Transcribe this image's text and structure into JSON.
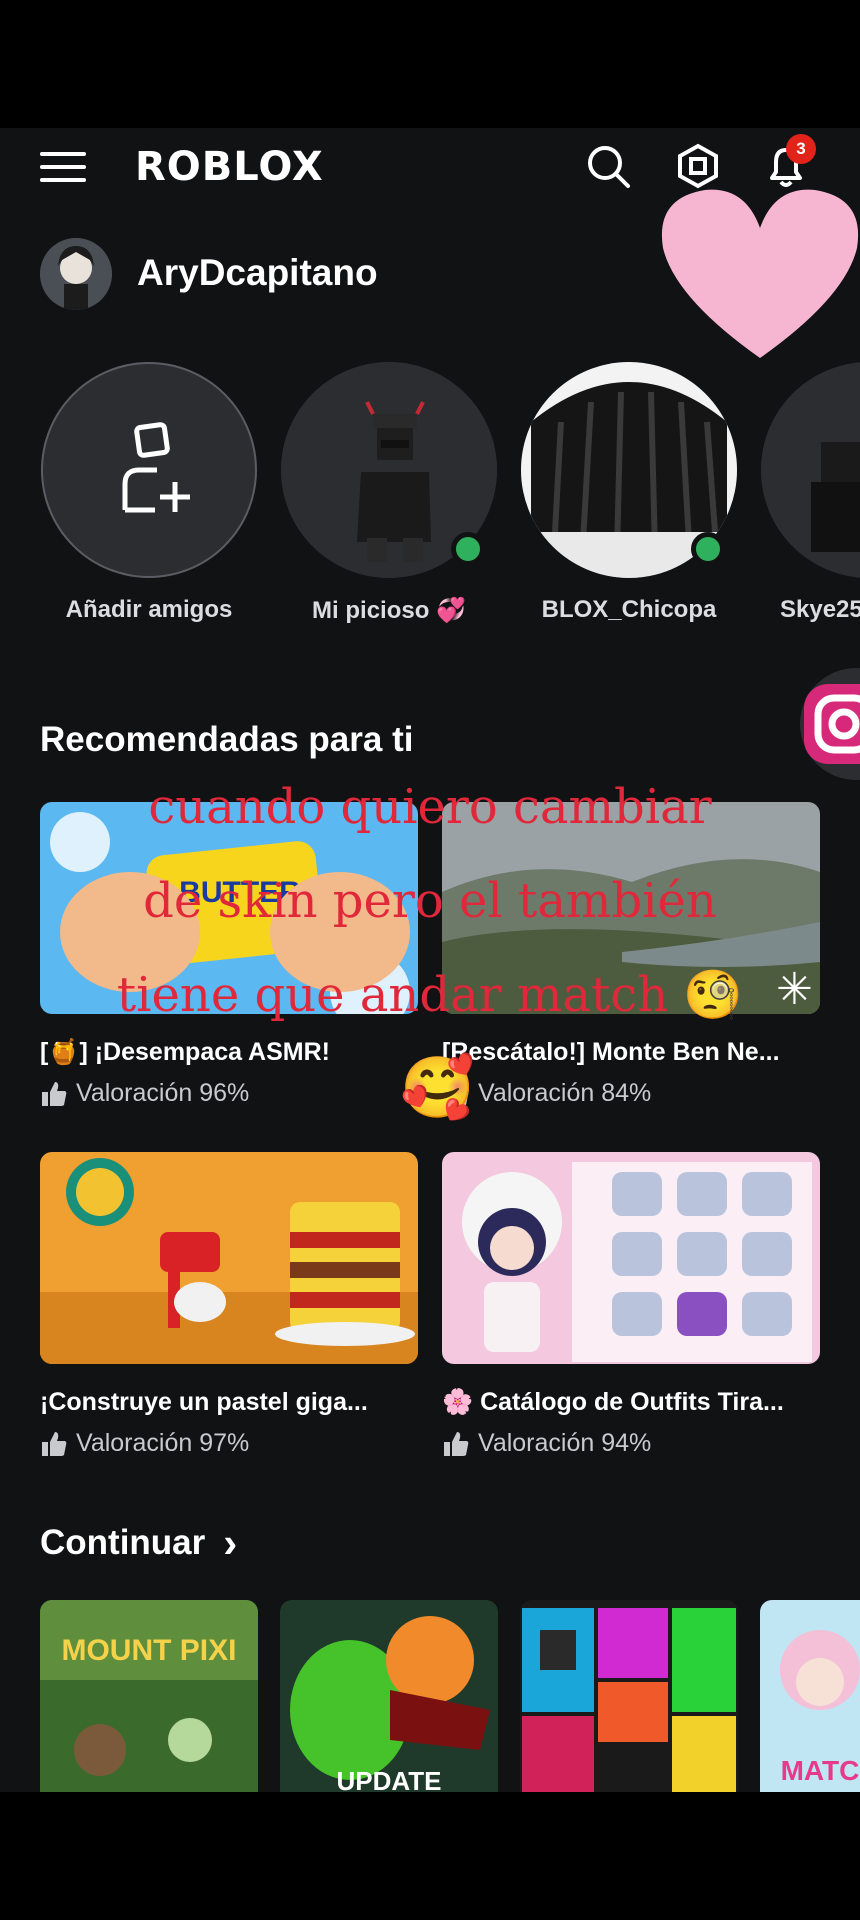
{
  "header": {
    "logo": "RΟBLOX",
    "notifications_count": "3",
    "icons": [
      "menu-icon",
      "search-icon",
      "robux-icon",
      "bell-icon"
    ]
  },
  "profile": {
    "username": "AryDcapitano"
  },
  "friends": [
    {
      "name": "Añadir amigos",
      "type": "add"
    },
    {
      "name": "Mi picioso 💞",
      "online": true
    },
    {
      "name": "BLOX_Chicopa",
      "online": true
    },
    {
      "name": "Skye25",
      "online": false
    }
  ],
  "recommended": {
    "title": "Recomendadas para ti",
    "games": [
      {
        "title": "[🍯] ¡Desempaca ASMR!",
        "rating": "Valoración 96%"
      },
      {
        "title": "[Rescátalo!] Monte Ben Ne...",
        "rating": "Valoración 84%"
      },
      {
        "title": "¡Construye un pastel giga...",
        "rating": "Valoración 97%"
      },
      {
        "title": "🌸 Catálogo de Outfits Tira...",
        "rating": "Valoración 94%"
      }
    ]
  },
  "continue": {
    "title": "Continuar",
    "chevron": "›",
    "games": [
      {
        "thumb_text": "MOUNT PIXI"
      },
      {
        "thumb_text": "UPDATE"
      },
      {
        "thumb_text": ""
      },
      {
        "thumb_text": "MATC"
      }
    ]
  },
  "overlay": {
    "lines": [
      "cuando quiero cambiar",
      "de skin pero el también",
      "tiene que andar match 🧐"
    ],
    "emoji_face": "🥰",
    "sparkle": "✳"
  },
  "colors": {
    "background": "#111214",
    "online": "#2fb05c",
    "badge": "#e2231a",
    "overlay_text": "#e0283a"
  }
}
